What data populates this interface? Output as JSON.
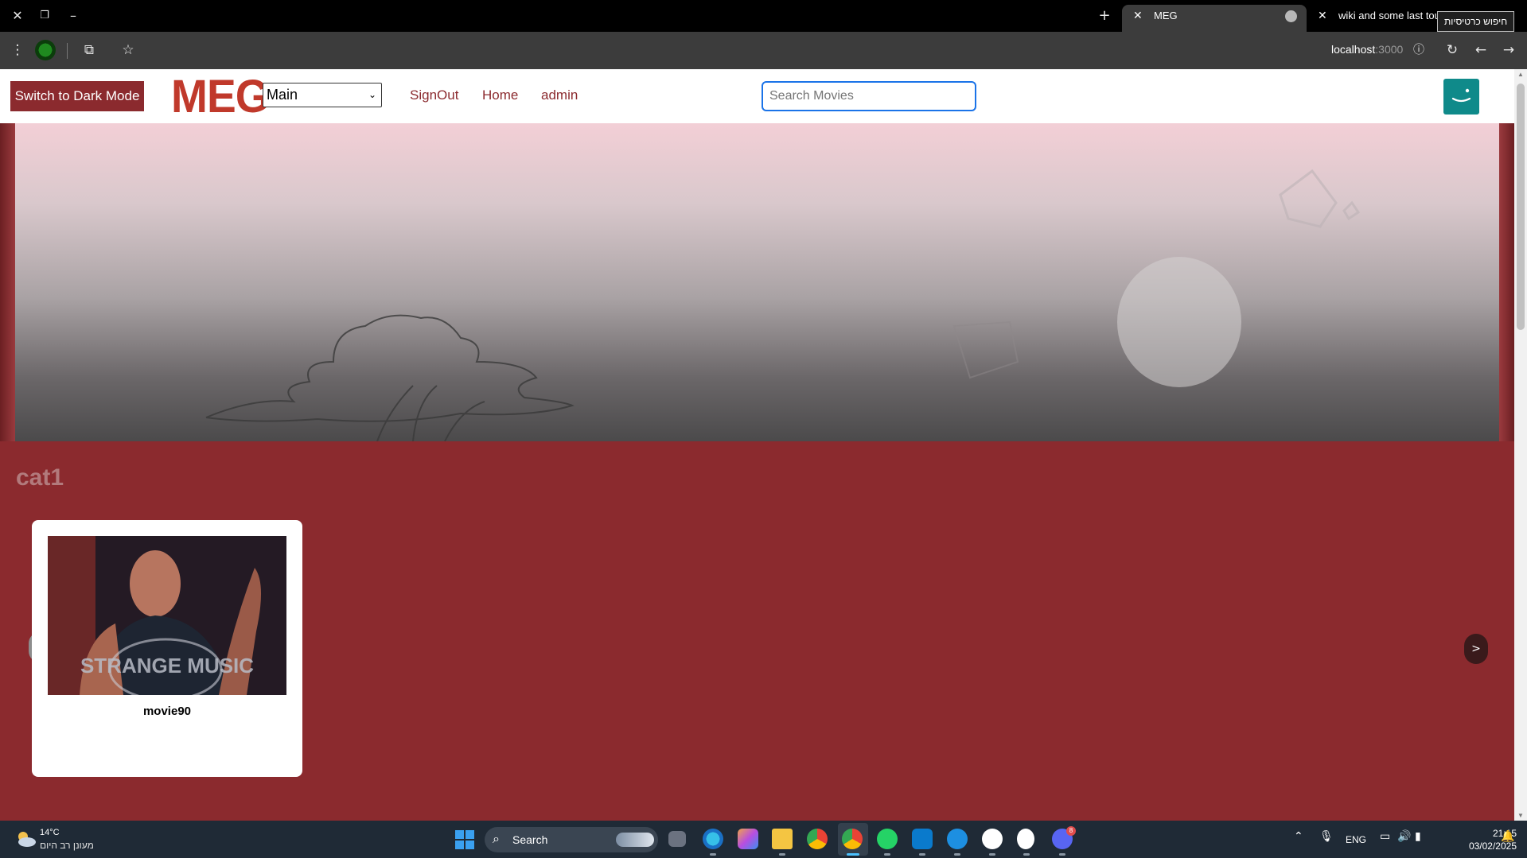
{
  "browser": {
    "tabs": [
      {
        "title": "MEG",
        "active": true
      },
      {
        "title": "wiki and some last touc",
        "active": false
      }
    ],
    "tooltip": "חיפוש כרטיסיות",
    "url_host": "localhost",
    "url_port": ":3000"
  },
  "navbar": {
    "dark_mode_label": "Switch to Dark Mode",
    "logo_text": "MEG",
    "select_value": "Main",
    "links": [
      "SignOut",
      "Home",
      "admin"
    ],
    "search_placeholder": "Search Movies"
  },
  "content": {
    "category_title": "cat1",
    "movies": [
      {
        "title": "movie90",
        "poster_text": "STRANGE MUSIC"
      }
    ],
    "prev_arrow": "<",
    "next_arrow": ">"
  },
  "taskbar": {
    "weather_temp": "14°C",
    "weather_desc": "מעונן רב היום",
    "search_label": "Search",
    "lang": "ENG",
    "time": "21:15",
    "date": "03/02/2025",
    "discord_badge": "8"
  },
  "colors": {
    "brand": "#8b2a2e",
    "logo": "#c0392b",
    "avatar": "#0f8a8a",
    "search_focus": "#1a73e8"
  }
}
